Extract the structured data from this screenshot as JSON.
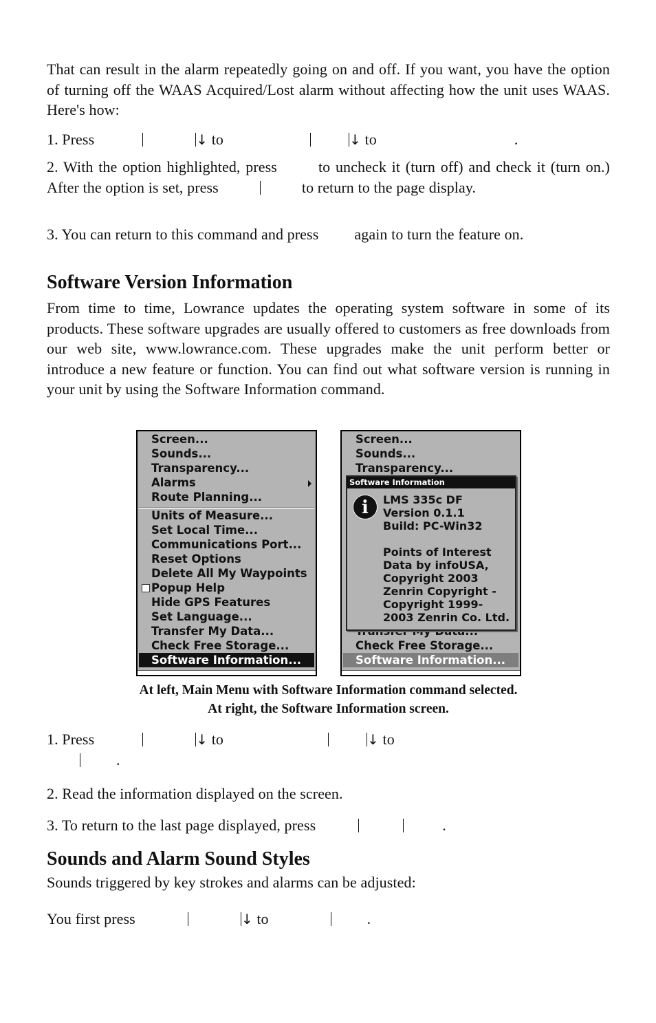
{
  "intro": {
    "paragraph": "That can result in the alarm repeatedly going on and off. If you want, you have the option of turning off the WAAS Acquired/Lost alarm without affecting how the unit uses WAAS. Here's how:",
    "step1": {
      "prefix": "1. Press",
      "to1": "to",
      "to2": "to",
      "end": "."
    },
    "step2": {
      "part1": "2. With the option highlighted, press",
      "part2": "to uncheck it (turn off) and check it (turn on.) After the option is set, press",
      "part3": "to return to the page display."
    },
    "step3": {
      "part1": "3. You can return to this command and press",
      "part2": "again to turn the feature on."
    }
  },
  "software_section": {
    "heading": "Software Version Information",
    "paragraph": "From time to time, Lowrance updates the operating system software in some of its products. These software upgrades are usually offered to customers as free downloads from our web site, www.lowrance.com. These upgrades make the unit perform better or introduce a new feature or function. You can find out what software version is running in your unit by using the Software Information command."
  },
  "left_screen": {
    "menu_items": [
      {
        "label": "Screen..."
      },
      {
        "label": "Sounds..."
      },
      {
        "label": "Transparency..."
      },
      {
        "label": "Alarms",
        "submenu": true
      },
      {
        "label": "Route Planning..."
      },
      {
        "label": "Units of Measure..."
      },
      {
        "label": "Set Local Time..."
      },
      {
        "label": "Communications Port..."
      },
      {
        "label": "Reset Options"
      },
      {
        "label": "Delete All My Waypoints"
      },
      {
        "label": "Popup Help",
        "checkbox": true,
        "checked": false
      },
      {
        "label": "Hide GPS Features"
      },
      {
        "label": "Set Language..."
      },
      {
        "label": "Transfer My Data..."
      },
      {
        "label": "Check Free Storage..."
      },
      {
        "label": "Software Information...",
        "selected": true
      }
    ],
    "colors": {
      "background": "#b4b4b4",
      "selected_bg": "#111111",
      "selected_fg": "#ffffff"
    }
  },
  "right_screen": {
    "menu_items_visible": [
      {
        "label": "Screen..."
      },
      {
        "label": "Sounds..."
      },
      {
        "label": "Transparency..."
      },
      {
        "label": "Transfer My Data..."
      },
      {
        "label": "Check Free Storage..."
      },
      {
        "label": "Software Information...",
        "selected": true
      }
    ],
    "dialog": {
      "title": "Software Information",
      "icon": "info-icon",
      "lines": [
        "LMS 335c DF",
        "Version 0.1.1",
        "Build: PC-Win32",
        "",
        "Points of Interest",
        "Data by infoUSA,",
        "Copyright 2003",
        "Zenrin Copyright -",
        "Copyright 1999-",
        "2003 Zenrin Co. Ltd."
      ]
    },
    "colors": {
      "background": "#b4b4b4",
      "selected_bg": "#7e7e7e",
      "selected_fg": "#ffffff"
    }
  },
  "caption": {
    "line1": "At left, Main Menu with Software Information command selected.",
    "line2": "At right, the Software Information screen."
  },
  "software_steps": {
    "step1": {
      "prefix": "1. Press",
      "to1": "to",
      "to2": "to",
      "end": "."
    },
    "step2": "2. Read the information displayed on the screen.",
    "step3": {
      "prefix": "3. To return to the last page displayed, press",
      "end": "."
    }
  },
  "sounds_section": {
    "heading": "Sounds and Alarm Sound Styles",
    "paragraph": "Sounds triggered by key strokes and alarms can be adjusted:",
    "step": {
      "prefix": "You first press",
      "to": "to",
      "end": "."
    }
  }
}
